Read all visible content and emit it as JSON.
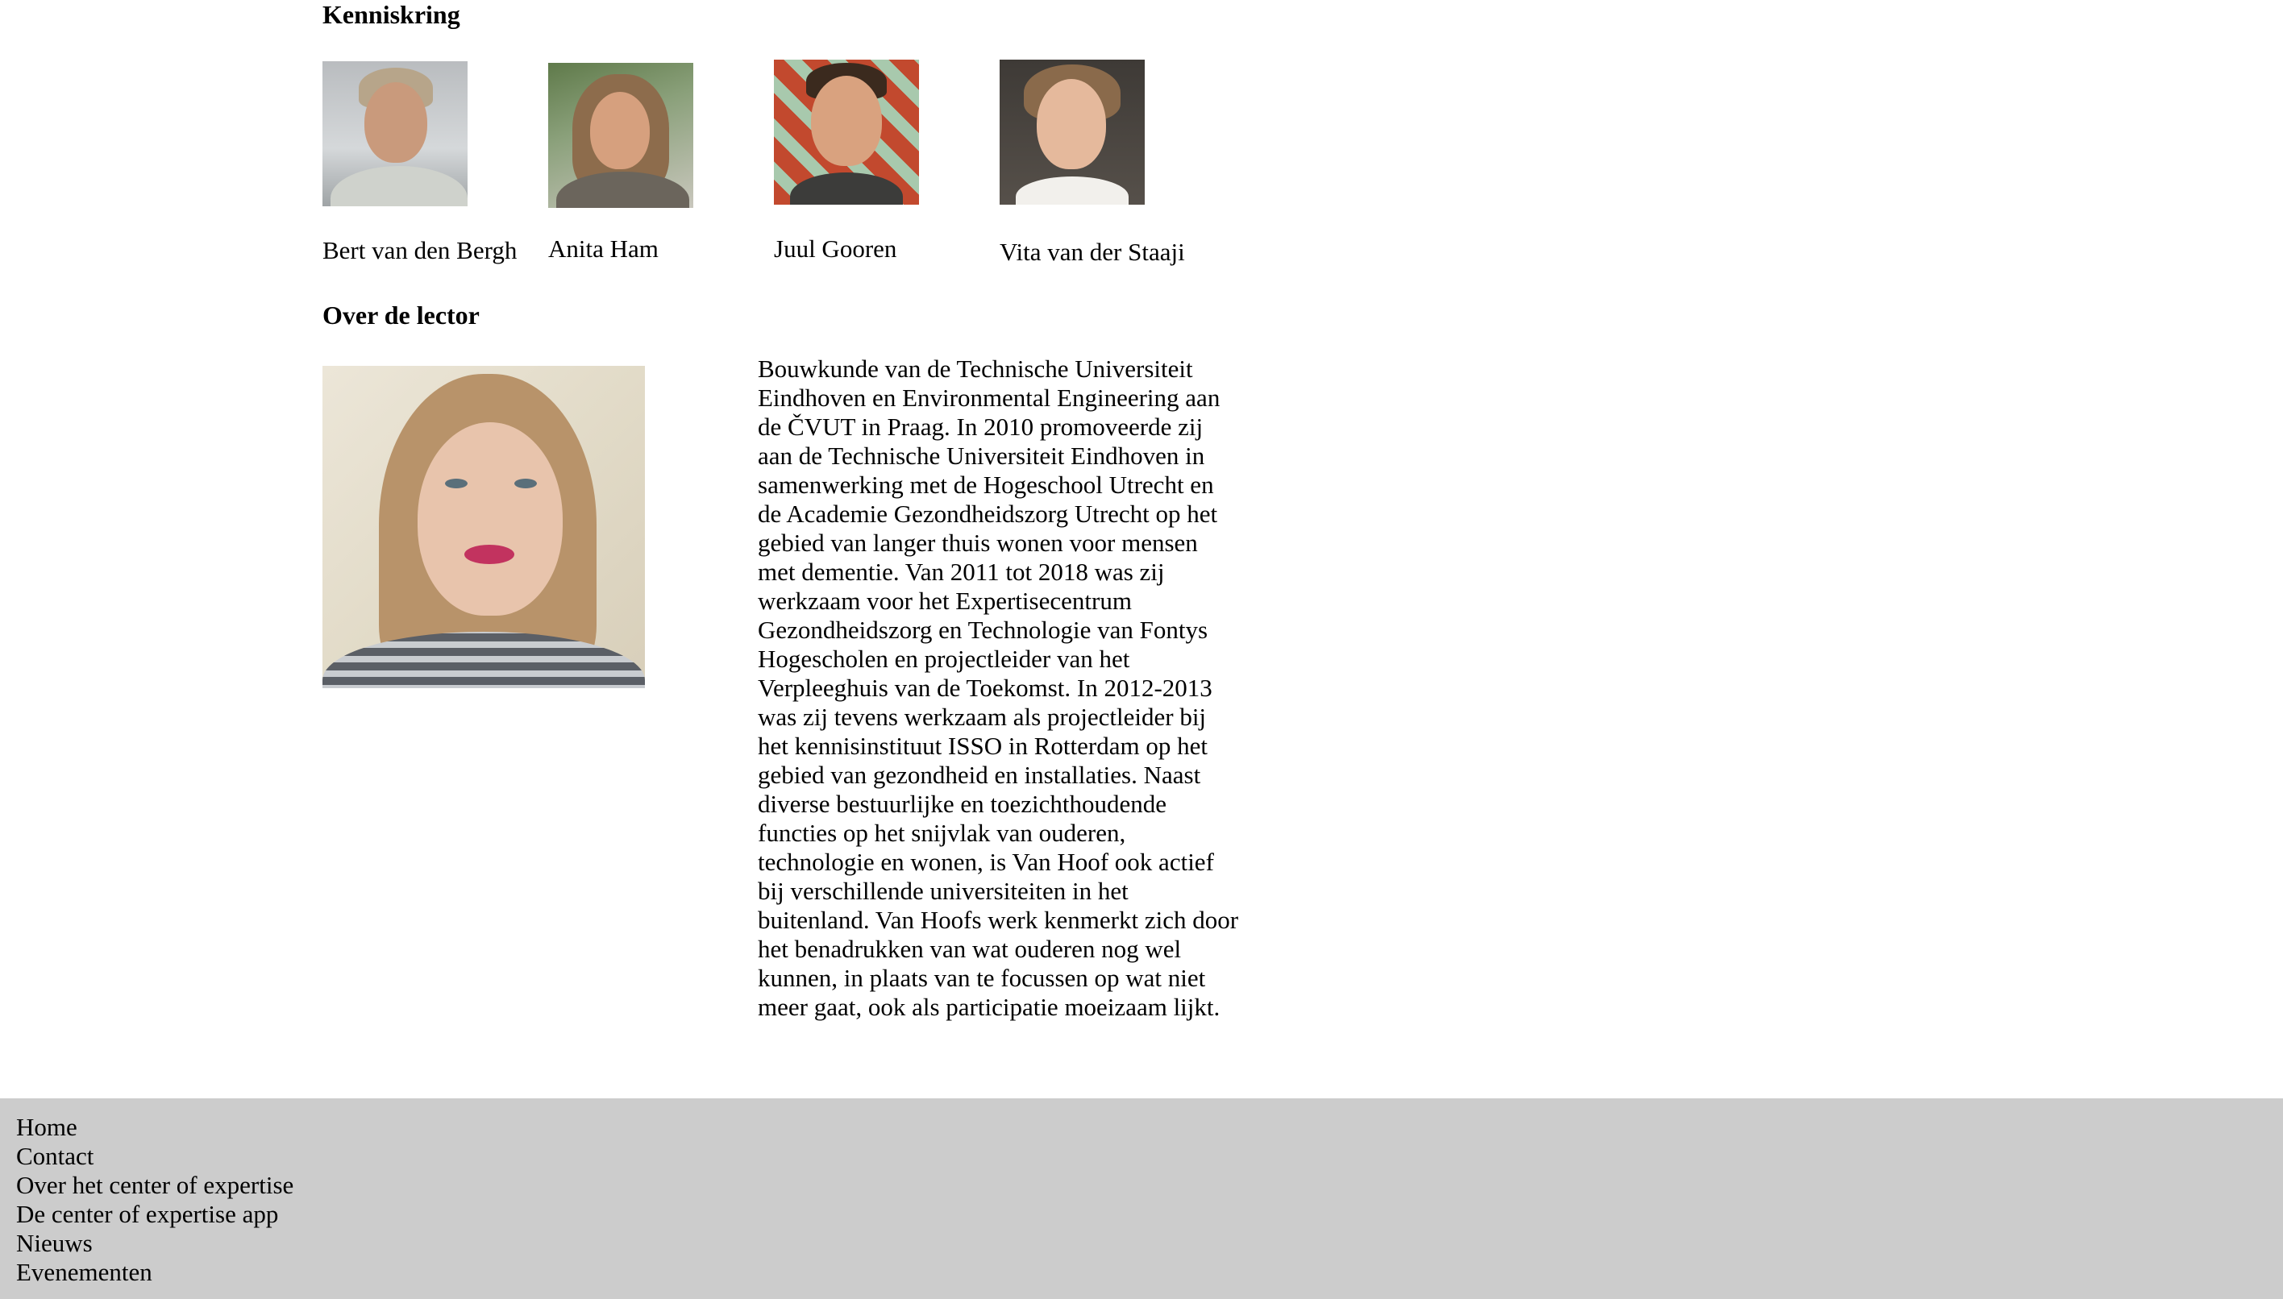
{
  "kenniskring": {
    "title": "Kenniskring",
    "members": [
      {
        "name": "Bert van den Bergh"
      },
      {
        "name": "Anita Ham"
      },
      {
        "name": "Juul Gooren"
      },
      {
        "name": "Vita van der Staaji"
      }
    ]
  },
  "lector": {
    "title": "Over de lector",
    "bio": "Bouwkunde van de Technische Universiteit Eindhoven en Environmental Engineering aan de ČVUT in Praag. In 2010 promoveerde zij aan de Technische Universiteit Eindhoven in samenwerking met de Hogeschool Utrecht en de Academie Gezondheidszorg Utrecht op het gebied van langer thuis wonen voor mensen met dementie. Van 2011 tot 2018 was zij werkzaam voor het Expertisecentrum Gezondheidszorg en Technologie van Fontys Hogescholen en projectleider van het Verpleeghuis van de Toekomst. In 2012-2013 was zij tevens werkzaam als projectleider bij het kennisinstituut ISSO in Rotterdam op het gebied van gezondheid en installaties. Naast diverse bestuurlijke en toezichthoudende functies op het snijvlak van ouderen, technologie en wonen, is Van Hoof ook actief bij verschillende universiteiten in het buitenland. Van Hoofs werk kenmerkt zich door het benadrukken van wat ouderen nog wel kunnen, in plaats van te focussen op wat niet meer gaat, ook als participatie moeizaam lijkt."
  },
  "footer": {
    "links": [
      "Home",
      "Contact",
      "Over het center of expertise",
      "De center of expertise app",
      "Nieuws",
      "Evenementen"
    ]
  }
}
